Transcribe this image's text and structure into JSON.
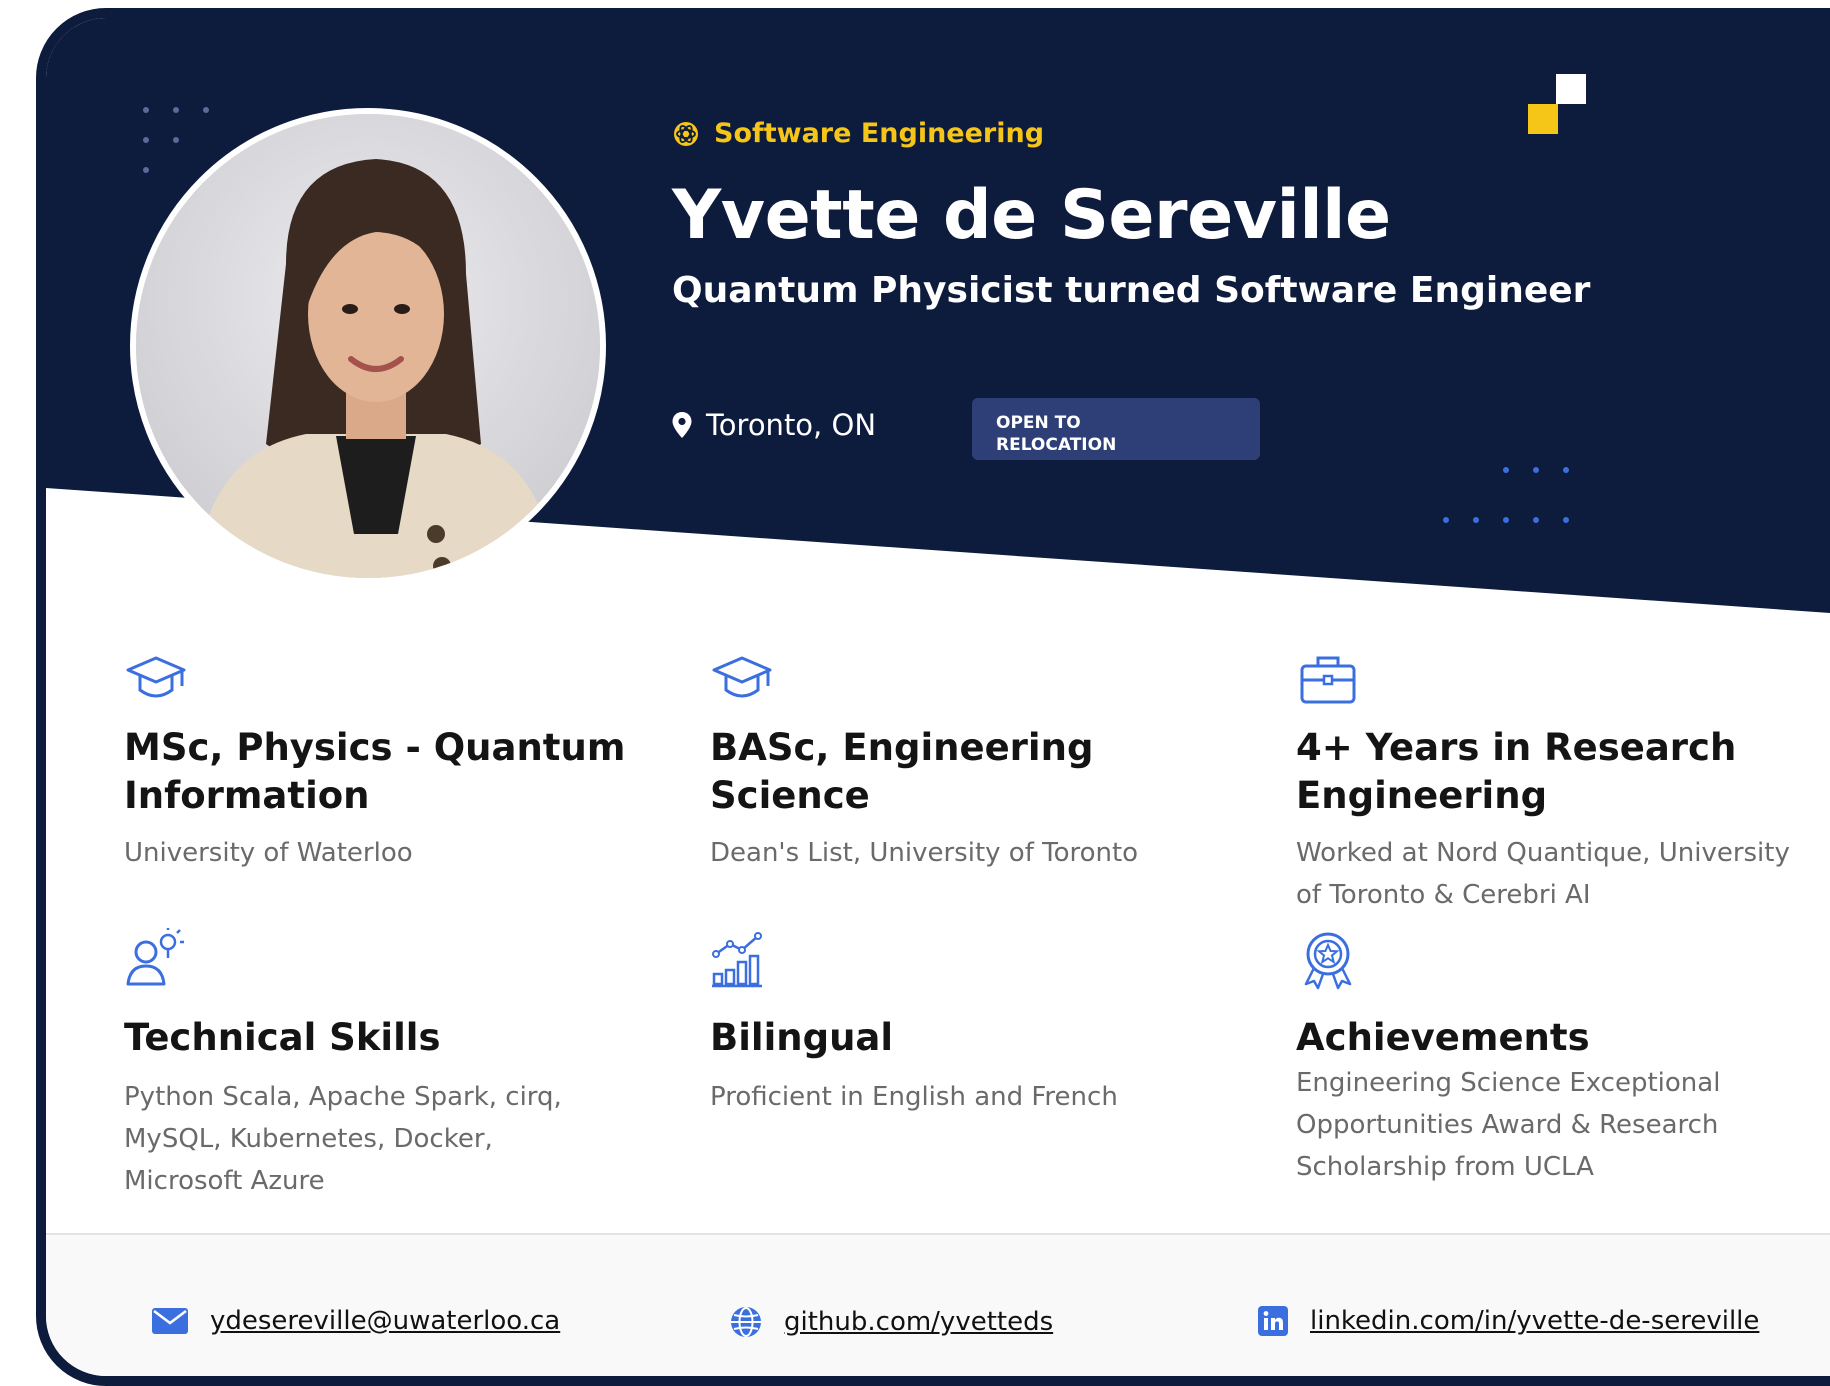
{
  "header": {
    "category": "Software Engineering",
    "name": "Yvette de Sereville",
    "tagline": "Quantum Physicist turned Software Engineer",
    "location": "Toronto, ON",
    "badge": "OPEN TO RELOCATION"
  },
  "features": [
    {
      "icon": "graduation-cap-icon",
      "title": "MSc, Physics - Quantum Information",
      "description": "University of Waterloo"
    },
    {
      "icon": "graduation-cap-icon",
      "title": "BASc, Engineering Science",
      "description": "Dean's List, University of Toronto"
    },
    {
      "icon": "briefcase-icon",
      "title": "4+ Years in Research Engineering",
      "description": "Worked at Nord Quantique, University of Toronto & Cerebri AI"
    },
    {
      "icon": "person-idea-icon",
      "title": "Technical Skills",
      "description": "Python Scala, Apache Spark, cirq, MySQL, Kubernetes, Docker, Microsoft Azure"
    },
    {
      "icon": "chart-growth-icon",
      "title": "Bilingual",
      "description": "Proficient in English and French"
    },
    {
      "icon": "award-ribbon-icon",
      "title": "Achievements",
      "description": "Engineering Science Exceptional Opportunities Award & Research Scholarship from UCLA"
    }
  ],
  "footer": {
    "email": "ydesereville@uwaterloo.ca",
    "github": "github.com/yvetteds",
    "linkedin": "linkedin.com/in/yvette-de-sereville"
  },
  "colors": {
    "navy": "#0d1b3c",
    "accent_yellow": "#f5c518",
    "icon_blue": "#3b6fe0",
    "badge_bg": "#2e3f78"
  }
}
